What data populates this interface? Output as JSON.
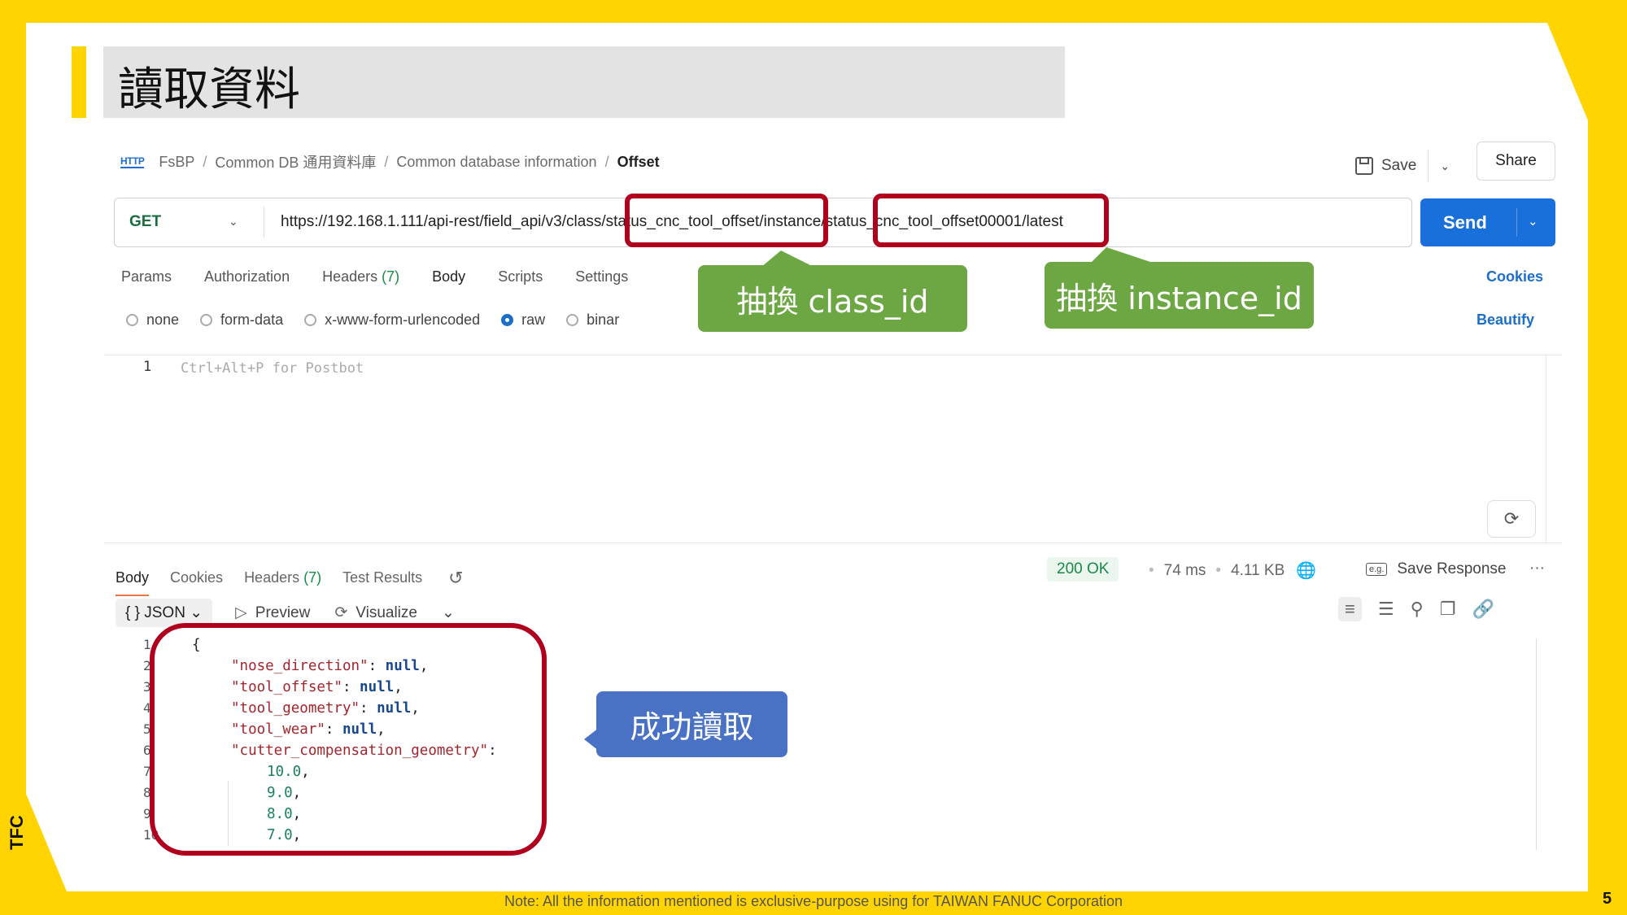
{
  "slide": {
    "title": "讀取資料",
    "footer_note": "Note: All the information mentioned is exclusive-purpose using for TAIWAN FANUC Corporation",
    "page_number": "5",
    "logo_text": "TFC"
  },
  "breadcrumb": {
    "icon": "http-icon",
    "items": [
      "FsBP",
      "Common DB 通用資料庫",
      "Common database information"
    ],
    "current": "Offset",
    "separator": "/"
  },
  "header_actions": {
    "save_label": "Save",
    "share_label": "Share"
  },
  "request": {
    "method": "GET",
    "url": "https://192.168.1.111/api-rest/field_api/v3/class/status_cnc_tool_offset/instance/status_cnc_tool_offset00001/latest",
    "send_label": "Send"
  },
  "request_tabs": {
    "params": "Params",
    "authorization": "Authorization",
    "headers": "Headers",
    "headers_count": "(7)",
    "body": "Body",
    "scripts": "Scripts",
    "settings": "Settings",
    "cookies": "Cookies"
  },
  "body_options": {
    "none": "none",
    "form_data": "form-data",
    "urlencoded": "x-www-form-urlencoded",
    "raw": "raw",
    "binary": "binar",
    "selected": "raw",
    "beautify": "Beautify"
  },
  "editor": {
    "line_number": "1",
    "placeholder": "Ctrl+Alt+P for Postbot"
  },
  "callouts": {
    "class_id": "抽換 class_id",
    "instance_id": "抽換 instance_id",
    "success": "成功讀取"
  },
  "response": {
    "tabs": {
      "body": "Body",
      "cookies": "Cookies",
      "headers": "Headers",
      "headers_count": "(7)",
      "test_results": "Test Results"
    },
    "status": "200 OK",
    "time": "74 ms",
    "size": "4.11 KB",
    "save_response": "Save Response",
    "format": "JSON",
    "preview": "Preview",
    "visualize": "Visualize",
    "code": {
      "l1": "{",
      "l2_key": "\"nose_direction\"",
      "l3_key": "\"tool_offset\"",
      "l4_key": "\"tool_geometry\"",
      "l5_key": "\"tool_wear\"",
      "l6_key": "\"cutter_compensation_geometry\"",
      "null_val": "null",
      "v7": "10.0",
      "v8": "9.0",
      "v9": "8.0",
      "v10": "7.0",
      "n1": "1",
      "n2": "2",
      "n3": "3",
      "n4": "4",
      "n5": "5",
      "n6": "6",
      "n7": "7",
      "n8": "8",
      "n9": "9",
      "n10": "10"
    }
  },
  "colors": {
    "brand_yellow": "#FFD400",
    "send_blue": "#1970DA",
    "highlight_red": "#B0001E",
    "callout_green": "#6CA743",
    "callout_blue": "#4A72C4"
  }
}
